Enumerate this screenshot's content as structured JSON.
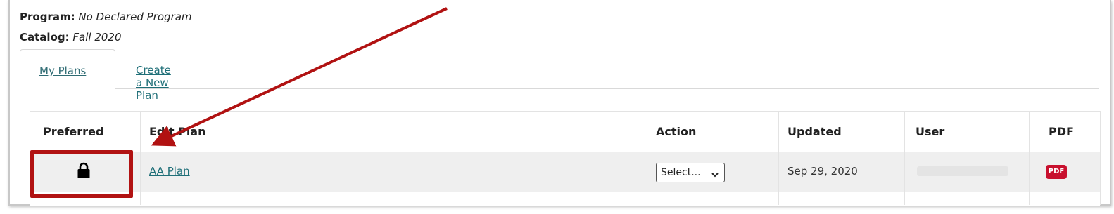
{
  "meta": {
    "program_label": "Program:",
    "program_value": "No Declared Program",
    "catalog_label": "Catalog:",
    "catalog_value": "Fall 2020"
  },
  "tabs": [
    {
      "label": "My Plans",
      "active": true
    },
    {
      "label": "Create a New Plan",
      "active": false
    }
  ],
  "table": {
    "headers": [
      "Preferred",
      "Edit Plan",
      "Action",
      "Updated",
      "User",
      "PDF"
    ],
    "rows": [
      {
        "preferred_icon": "lock-icon",
        "plan_name": "AA Plan",
        "action_select": "Select...",
        "updated": "Sep 29, 2020",
        "user": "",
        "pdf_badge": "PDF"
      }
    ]
  },
  "annotation": {
    "color": "#b11212"
  },
  "colors": {
    "link": "#1f6f78",
    "pdf_badge": "#c8102e",
    "row_bg": "#efefef"
  }
}
